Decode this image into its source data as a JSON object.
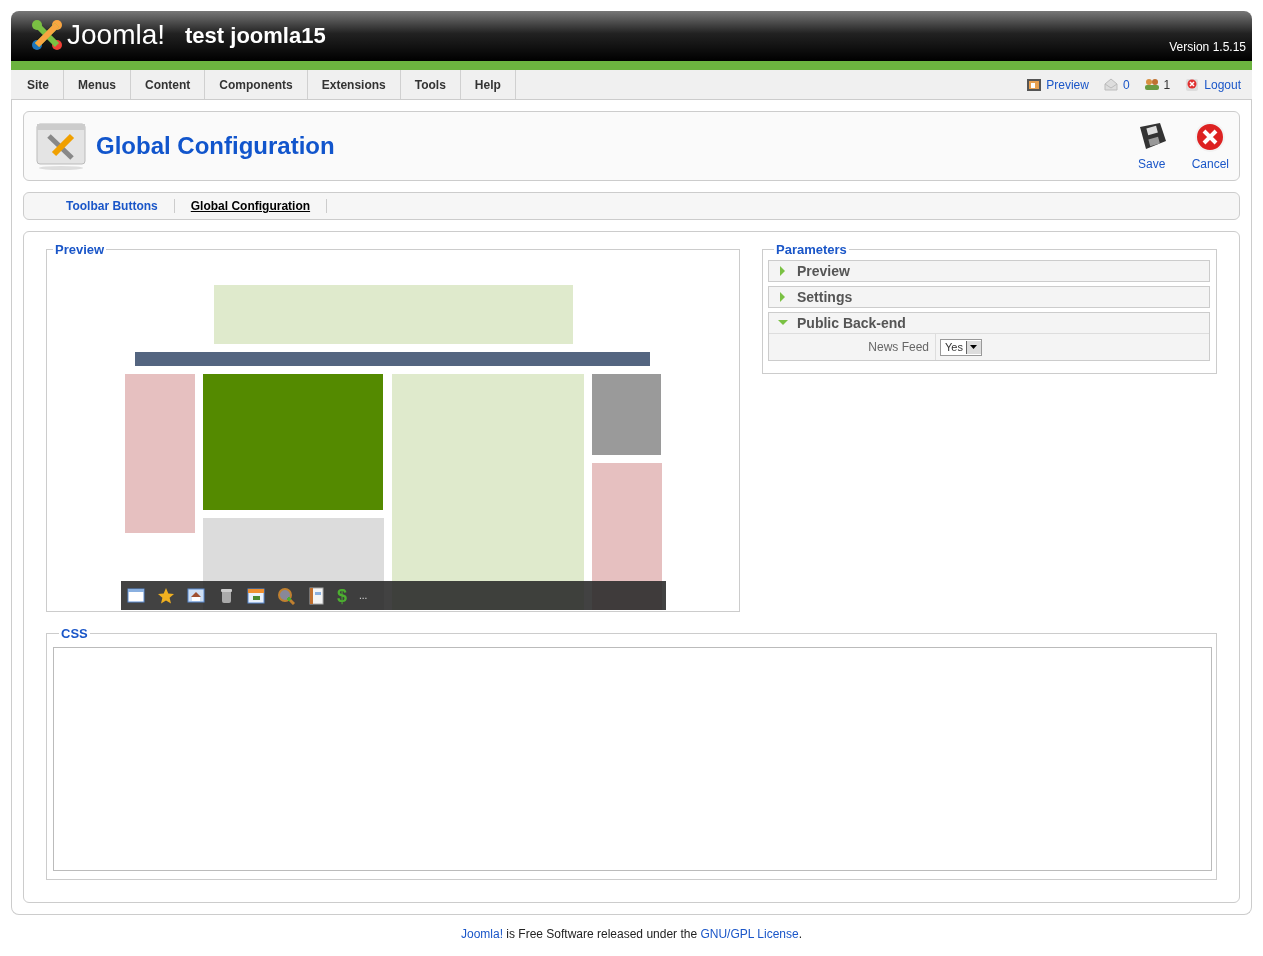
{
  "header": {
    "logo": "Joomla!",
    "site_name": "test joomla15",
    "version": "Version 1.5.15"
  },
  "menu": [
    {
      "label": "Site"
    },
    {
      "label": "Menus"
    },
    {
      "label": "Content"
    },
    {
      "label": "Components"
    },
    {
      "label": "Extensions"
    },
    {
      "label": "Tools"
    },
    {
      "label": "Help"
    }
  ],
  "status": [
    {
      "kind": "preview",
      "label": "Preview"
    },
    {
      "kind": "messages",
      "label": "0"
    },
    {
      "kind": "users",
      "label": "1"
    },
    {
      "kind": "logout",
      "label": "Logout"
    }
  ],
  "page_title": "Global Configuration",
  "toolbar": [
    {
      "kind": "save",
      "label": "Save"
    },
    {
      "kind": "cancel",
      "label": "Cancel"
    }
  ],
  "submenu": [
    {
      "label": "Toolbar Buttons",
      "selected": false
    },
    {
      "label": "Global Configuration",
      "selected": true
    }
  ],
  "preview_panel": {
    "legend": "Preview",
    "dollar": "$",
    "more": "..."
  },
  "parameters": {
    "legend": "Parameters",
    "sections": [
      {
        "title": "Preview",
        "expanded": false
      },
      {
        "title": "Settings",
        "expanded": false
      },
      {
        "title": "Public Back-end",
        "expanded": true,
        "fields": [
          {
            "label": "News Feed",
            "value": "Yes"
          }
        ]
      }
    ]
  },
  "css_panel": {
    "legend": "CSS"
  },
  "footer": {
    "brand_link": "Joomla!",
    "text": " is Free Software released under the ",
    "license_link": "GNU/GPL License",
    "end": "."
  }
}
